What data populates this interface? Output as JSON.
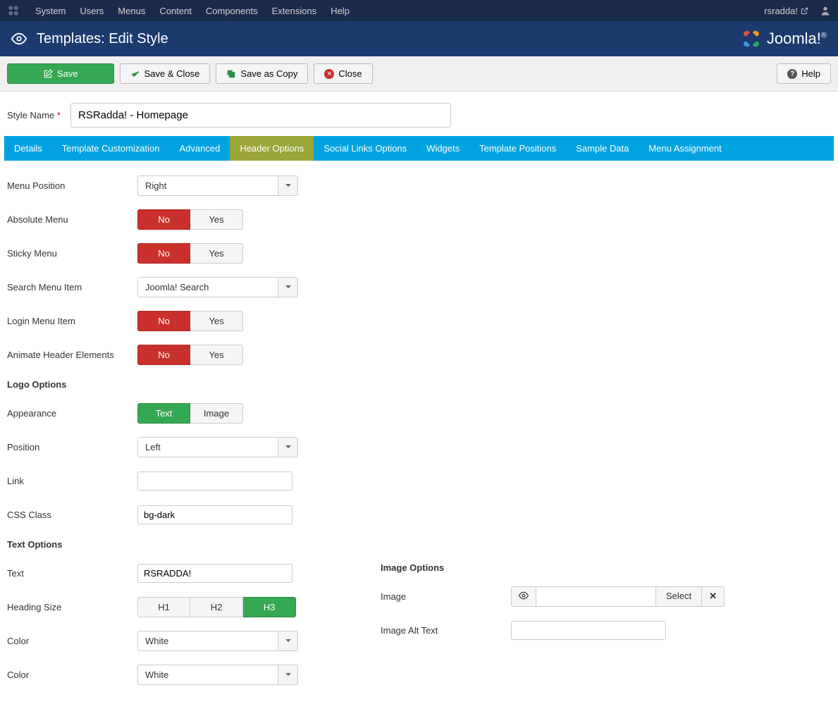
{
  "adminBar": {
    "menus": [
      "System",
      "Users",
      "Menus",
      "Content",
      "Components",
      "Extensions",
      "Help"
    ],
    "username": "rsradda!"
  },
  "titleBar": {
    "title": "Templates: Edit Style",
    "brand": "Joomla!"
  },
  "toolbar": {
    "save": "Save",
    "saveClose": "Save & Close",
    "saveCopy": "Save as Copy",
    "close": "Close",
    "help": "Help"
  },
  "styleName": {
    "label": "Style Name",
    "value": "RSRadda! - Homepage"
  },
  "tabs": [
    "Details",
    "Template Customization",
    "Advanced",
    "Header Options",
    "Social Links Options",
    "Widgets",
    "Template Positions",
    "Sample Data",
    "Menu Assignment"
  ],
  "activeTab": 3,
  "form": {
    "menuPosition": {
      "label": "Menu Position",
      "value": "Right"
    },
    "absoluteMenu": {
      "label": "Absolute Menu",
      "no": "No",
      "yes": "Yes"
    },
    "stickyMenu": {
      "label": "Sticky Menu",
      "no": "No",
      "yes": "Yes"
    },
    "searchMenuItem": {
      "label": "Search Menu Item",
      "value": "Joomla! Search"
    },
    "loginMenuItem": {
      "label": "Login Menu Item",
      "no": "No",
      "yes": "Yes"
    },
    "animateHeader": {
      "label": "Animate Header Elements",
      "no": "No",
      "yes": "Yes"
    },
    "logoOptions": "Logo Options",
    "appearance": {
      "label": "Appearance",
      "text": "Text",
      "image": "Image"
    },
    "position": {
      "label": "Position",
      "value": "Left"
    },
    "link": {
      "label": "Link",
      "value": ""
    },
    "cssClass": {
      "label": "CSS Class",
      "value": "bg-dark"
    },
    "textOptions": "Text Options",
    "text": {
      "label": "Text",
      "value": "RSRADDA!"
    },
    "headingSize": {
      "label": "Heading Size",
      "h1": "H1",
      "h2": "H2",
      "h3": "H3"
    },
    "color1": {
      "label": "Color",
      "value": "White"
    },
    "color2": {
      "label": "Color",
      "value": "White"
    },
    "imageOptions": "Image Options",
    "image": {
      "label": "Image",
      "select": "Select"
    },
    "imageAltText": {
      "label": "Image Alt Text",
      "value": ""
    }
  }
}
